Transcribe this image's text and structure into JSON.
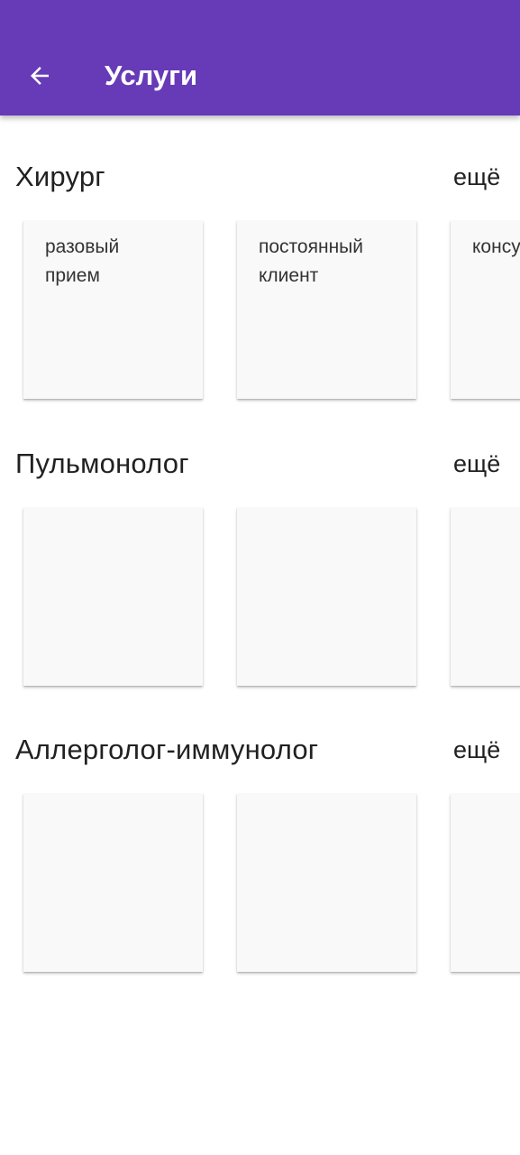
{
  "appbar": {
    "title": "Услуги",
    "back_icon": "arrow-back-icon"
  },
  "colors": {
    "primary": "#673ab7",
    "card_background": "#f9f9f9",
    "text": "#212121"
  },
  "sections": [
    {
      "title": "Хирург",
      "more_label": "ещё",
      "cards": [
        {
          "label": "разовый\nприем"
        },
        {
          "label": "постоянный\nклиент"
        },
        {
          "label": "консультация"
        }
      ]
    },
    {
      "title": "Пульмонолог",
      "more_label": "ещё",
      "cards": [
        {
          "label": ""
        },
        {
          "label": ""
        },
        {
          "label": ""
        }
      ]
    },
    {
      "title": "Аллерголог-иммунолог",
      "more_label": "ещё",
      "cards": [
        {
          "label": ""
        },
        {
          "label": ""
        },
        {
          "label": ""
        }
      ]
    }
  ]
}
